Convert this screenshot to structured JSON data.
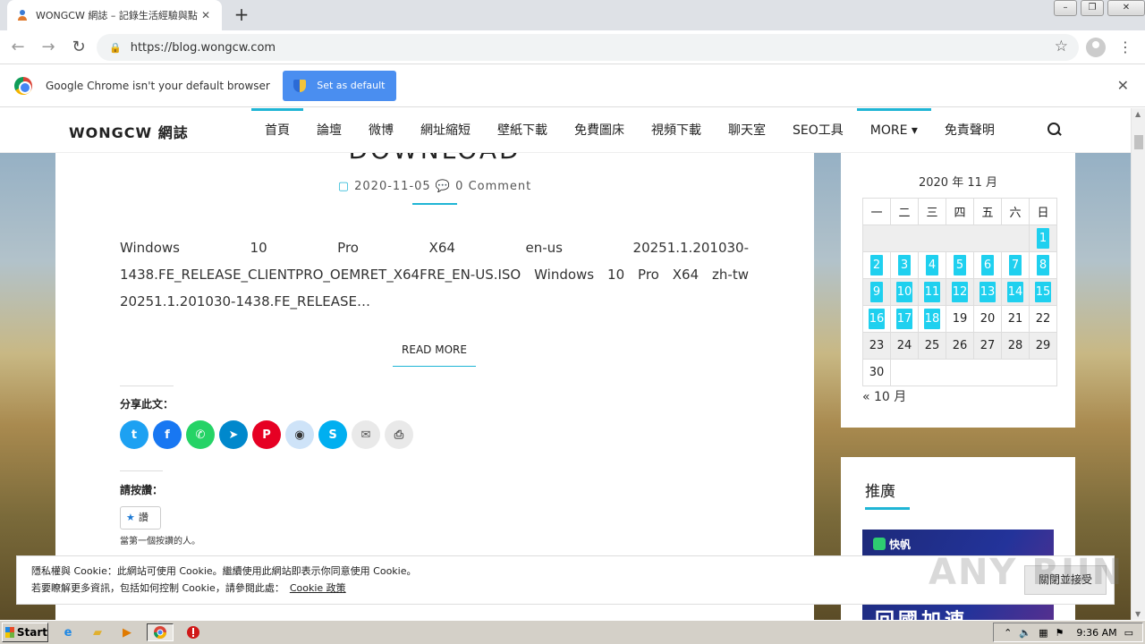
{
  "browser": {
    "tab_title": "WONGCW 網誌 – 記錄生活經驗與點",
    "url": "https://blog.wongcw.com",
    "infobar_message": "Google Chrome isn't your default browser",
    "set_default_label": "Set as default"
  },
  "site": {
    "brand": "WONGCW 網誌",
    "nav": [
      "首頁",
      "論壇",
      "微博",
      "網址縮短",
      "壁紙下載",
      "免費圖床",
      "視頻下載",
      "聊天室",
      "SEO工具",
      "MORE ▾",
      "免責聲明"
    ]
  },
  "post": {
    "title_fragment": "DOWNLOAD",
    "date": "2020-11-05",
    "comments": "0 Comment",
    "excerpt": "Windows 10 Pro X64 en-us 20251.1.201030-1438.FE_RELEASE_CLIENTPRO_OEMRET_X64FRE_EN-US.ISO Windows 10 Pro X64 zh-tw 20251.1.201030-1438.FE_RELEASE…",
    "read_more": "READ MORE",
    "share_label": "分享此文：",
    "share_buttons": [
      {
        "name": "twitter",
        "glyph": "t",
        "color": "#1da1f2"
      },
      {
        "name": "facebook",
        "glyph": "f",
        "color": "#1877f2"
      },
      {
        "name": "whatsapp",
        "glyph": "✆",
        "color": "#25d366"
      },
      {
        "name": "telegram",
        "glyph": "➤",
        "color": "#0088cc"
      },
      {
        "name": "pinterest",
        "glyph": "P",
        "color": "#e60023"
      },
      {
        "name": "reddit",
        "glyph": "◉",
        "color": "#cee3f8"
      },
      {
        "name": "skype",
        "glyph": "S",
        "color": "#00aff0"
      },
      {
        "name": "email",
        "glyph": "✉",
        "color": "#e9e9e9"
      },
      {
        "name": "print",
        "glyph": "⎙",
        "color": "#e9e9e9"
      }
    ],
    "like_label": "請按讚：",
    "like_button": "讚",
    "first_like": "當第一個按讚的人。"
  },
  "calendar": {
    "caption": "2020 年 11 月",
    "weekdays": [
      "一",
      "二",
      "三",
      "四",
      "五",
      "六",
      "日"
    ],
    "linked_days": [
      "1",
      "2",
      "3",
      "4",
      "5",
      "6",
      "7",
      "8",
      "9",
      "10",
      "11",
      "12",
      "13",
      "14",
      "15",
      "16",
      "17",
      "18"
    ],
    "rows": [
      [
        "",
        "",
        "",
        "",
        "",
        "",
        "1"
      ],
      [
        "2",
        "3",
        "4",
        "5",
        "6",
        "7",
        "8"
      ],
      [
        "9",
        "10",
        "11",
        "12",
        "13",
        "14",
        "15"
      ],
      [
        "16",
        "17",
        "18",
        "19",
        "20",
        "21",
        "22"
      ],
      [
        "23",
        "24",
        "25",
        "26",
        "27",
        "28",
        "29"
      ],
      [
        "30",
        "",
        "",
        "",
        "",
        "",
        ""
      ]
    ],
    "prev_month": "« 10 月"
  },
  "ad": {
    "heading": "推廣",
    "banner_tag": "快帆",
    "banner_text": "回國加速"
  },
  "cookie": {
    "line1": "隱私權與 Cookie：此網站可使用 Cookie。繼續使用此網站即表示你同意使用 Cookie。",
    "line2": "若要瞭解更多資訊，包括如何控制 Cookie，請參閱此處：",
    "policy_link": "Cookie 政策",
    "accept": "關閉並接受"
  },
  "watermark": "ANY RUN",
  "taskbar": {
    "start": "Start",
    "clock": "9:36 AM"
  }
}
